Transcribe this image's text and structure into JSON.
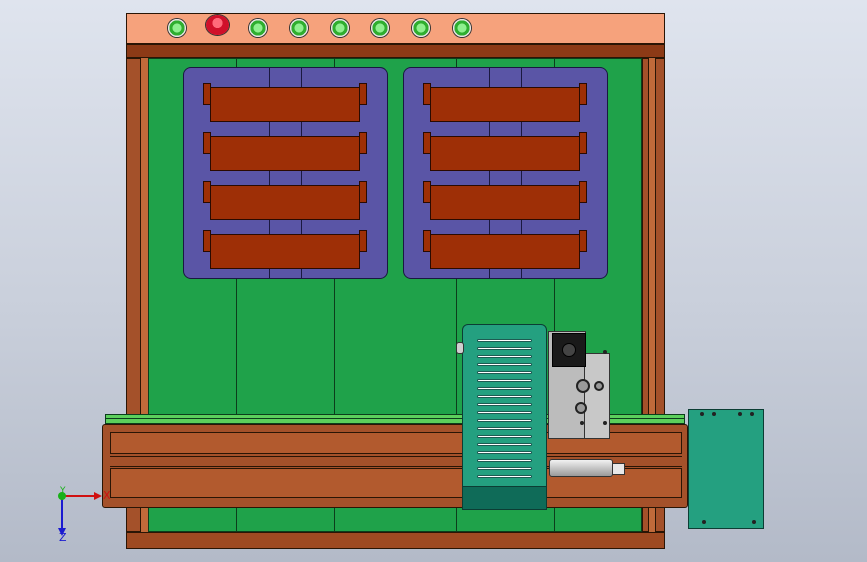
{
  "view": {
    "background": [
      "#dfe4ee",
      "#b3bac8"
    ],
    "triad_labels": {
      "x": "X",
      "y": "Y",
      "z": "Z"
    }
  },
  "control_panel": {
    "color": "#f6a27c",
    "buttons": [
      {
        "name": "indicator-1",
        "color": "green"
      },
      {
        "name": "emergency-stop",
        "color": "red"
      },
      {
        "name": "indicator-2",
        "color": "green"
      },
      {
        "name": "indicator-3",
        "color": "green"
      },
      {
        "name": "indicator-4",
        "color": "green"
      },
      {
        "name": "indicator-5",
        "color": "green"
      },
      {
        "name": "indicator-6",
        "color": "green"
      },
      {
        "name": "indicator-7",
        "color": "green"
      }
    ]
  },
  "frame": {
    "color": "#a4512a",
    "panel_color": "#1fa24a"
  },
  "magazines": [
    {
      "name": "left-magazine",
      "color": "#5a55a6",
      "trays": 4,
      "tray_color": "#9e2f06"
    },
    {
      "name": "right-magazine",
      "color": "#5a55a6",
      "trays": 4,
      "tray_color": "#9e2f06"
    }
  ],
  "rail": {
    "color": "#a4512a",
    "guide_color": "#5ccf5c"
  },
  "carriage": {
    "color": "#24a080",
    "vent_slots": 18
  },
  "electrical_box": {
    "color": "#24a080"
  }
}
